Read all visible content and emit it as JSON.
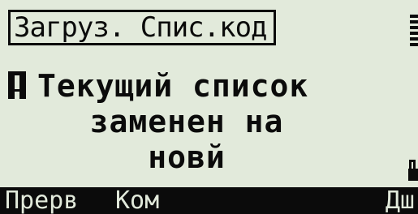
{
  "header": {
    "title": "Загруз. Спис.код"
  },
  "icons": {
    "battery": "battery-icon",
    "alert": "exclamation-icon",
    "lock": "lock-icon"
  },
  "message": {
    "line1": "Текущий список",
    "line2": "заменен на",
    "line3": "новй"
  },
  "softkeys": [
    {
      "label": "Прерв"
    },
    {
      "label": "Ком"
    },
    {
      "label": "Дш"
    }
  ],
  "colors": {
    "background": "#e2eadb",
    "foreground": "#0b0b0b"
  }
}
